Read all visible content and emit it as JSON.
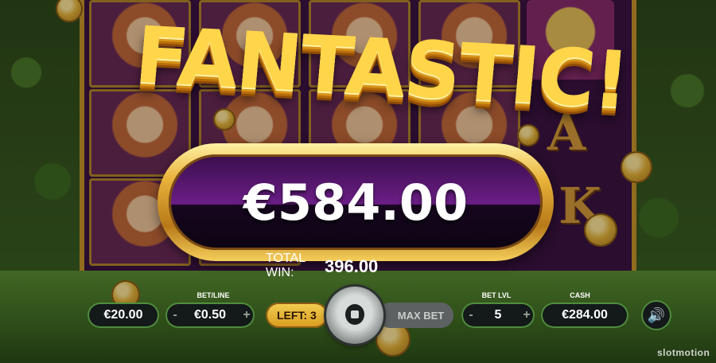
{
  "headline": "FANTASTIC!",
  "win": {
    "amount": "€584.00",
    "total_label": "TOTAL WIN:",
    "total_value": "396.00"
  },
  "hud": {
    "bet_total": "€20.00",
    "bet_line_caption": "BET/LINE",
    "bet_line_value": "€0.50",
    "minus": "-",
    "plus": "+",
    "left_label": "LEFT: 3",
    "max_bet_label": "MAX BET",
    "bet_lvl_caption": "BET LVL",
    "bet_lvl_value": "5",
    "cash_caption": "CASH",
    "cash_value": "€284.00",
    "sound_icon": "speaker-icon",
    "spin_icon": "stop-icon"
  },
  "reels": {
    "letter_symbols": [
      "A",
      "K"
    ]
  },
  "brand": "slotmotion",
  "colors": {
    "accent_gold": "#e9b33c",
    "win_panel": "#3a0e4c",
    "field_border": "#4f8d3d"
  }
}
